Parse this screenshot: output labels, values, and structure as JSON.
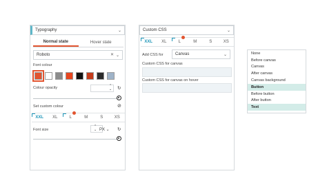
{
  "left_panel": {
    "group_select": "Typography",
    "tabs": [
      "Normal state",
      "Hover state"
    ],
    "font_select": "Roboto",
    "font_colour_label": "Font colour",
    "swatches": [
      "#e2542f",
      "#ffffff",
      "#8c8c8c",
      "#e8461f",
      "#111111",
      "#c43b1b",
      "#2a2a2a",
      "#9fb3c8"
    ],
    "opacity_label": "Colour opacity",
    "custom_colour_label": "Set custom colour",
    "breakpoints": [
      "XXL",
      "XL",
      "L",
      "M",
      "S",
      "XS"
    ],
    "font_size_label": "Font size",
    "unit": "PX"
  },
  "mid_panel": {
    "group_select": "Custom CSS",
    "breakpoints": [
      "XXL",
      "XL",
      "L",
      "M",
      "S",
      "XS"
    ],
    "add_css_label": "Add CSS for",
    "add_css_value": "Canvas",
    "custom_css_canvas": "Custom CSS for canvas",
    "custom_css_hover": "Custom CSS for canvas on hover"
  },
  "right_panel": {
    "options": [
      "None",
      "Before canvas",
      "Canvas",
      "After canvas",
      "Canvas background",
      "Button",
      "Before button",
      "After button",
      "Text"
    ],
    "highlighted": [
      "Button",
      "Text"
    ]
  },
  "colors": {
    "accent": "#e2542f",
    "brand": "#1c95b8",
    "highlight": "#d3ece8"
  }
}
